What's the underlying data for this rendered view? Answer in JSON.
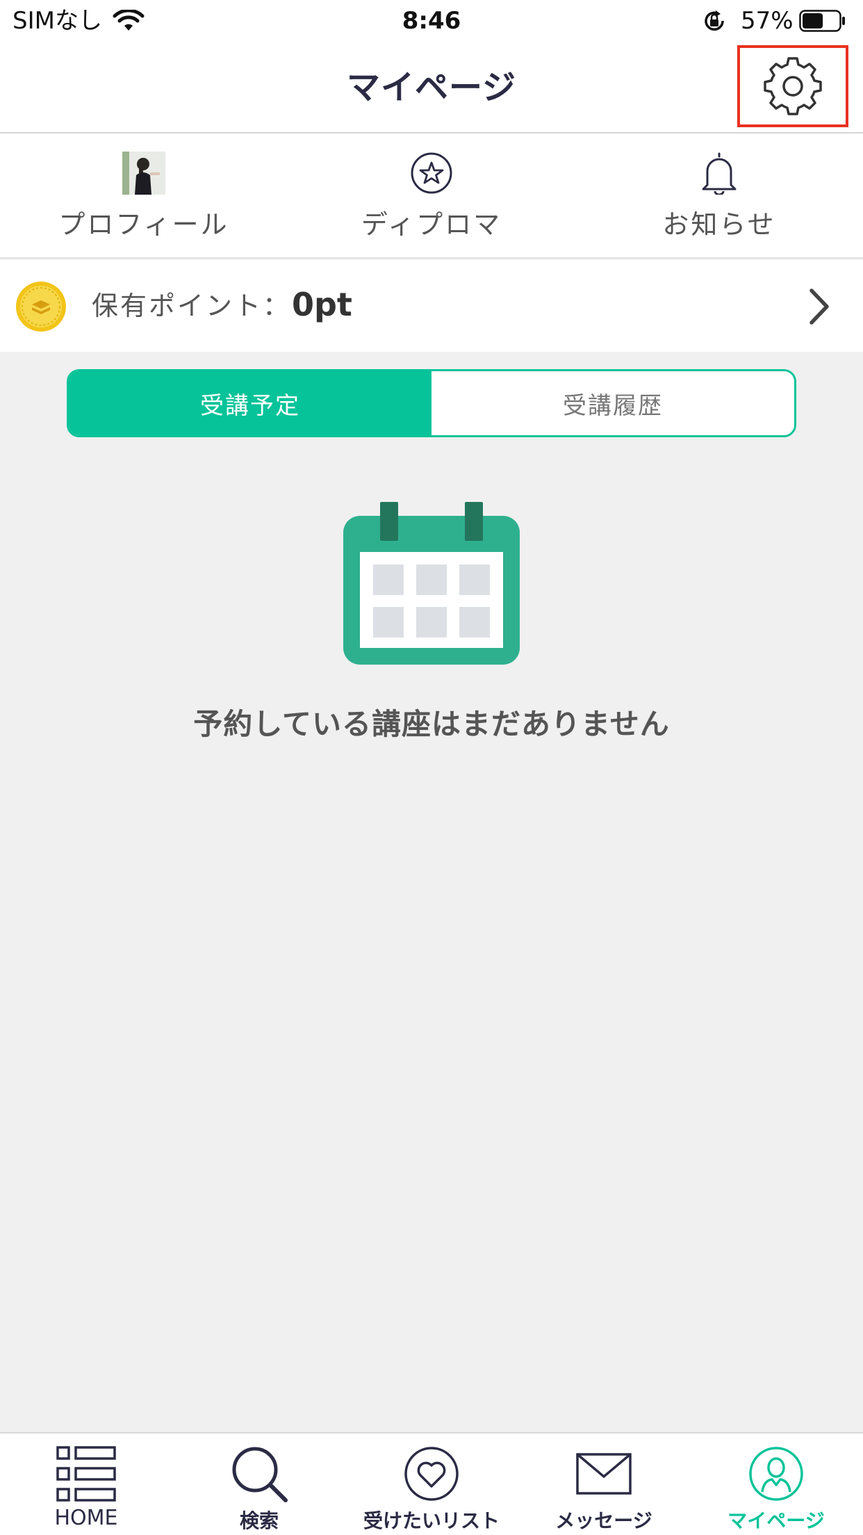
{
  "status_bar": {
    "carrier": "SIMなし",
    "time": "8:46",
    "battery_percent": "57%",
    "battery_level": 0.57
  },
  "header": {
    "title": "マイページ",
    "settings_icon": "gear-icon"
  },
  "quick_menu": [
    {
      "label": "プロフィール",
      "icon": "avatar"
    },
    {
      "label": "ディプロマ",
      "icon": "star-circle-icon"
    },
    {
      "label": "お知らせ",
      "icon": "bell-icon"
    }
  ],
  "points": {
    "label": "保有ポイント：",
    "value": "0pt",
    "icon": "coin-icon"
  },
  "segment": {
    "upcoming": "受講予定",
    "history": "受講履歴",
    "selected": "upcoming"
  },
  "empty_state": {
    "icon": "calendar-icon",
    "message": "予約している講座はまだありません"
  },
  "tab_bar": {
    "items": [
      {
        "label": "HOME",
        "icon": "list-grid-icon"
      },
      {
        "label": "検索",
        "icon": "search-icon"
      },
      {
        "label": "受けたいリスト",
        "icon": "heart-icon"
      },
      {
        "label": "メッセージ",
        "icon": "mail-icon"
      },
      {
        "label": "マイページ",
        "icon": "user-icon"
      }
    ],
    "active_index": 4
  },
  "colors": {
    "accent": "#06c399",
    "calendar": "#2eb08f",
    "highlight_border": "#e8321f",
    "text_dark": "#2b2b45"
  }
}
